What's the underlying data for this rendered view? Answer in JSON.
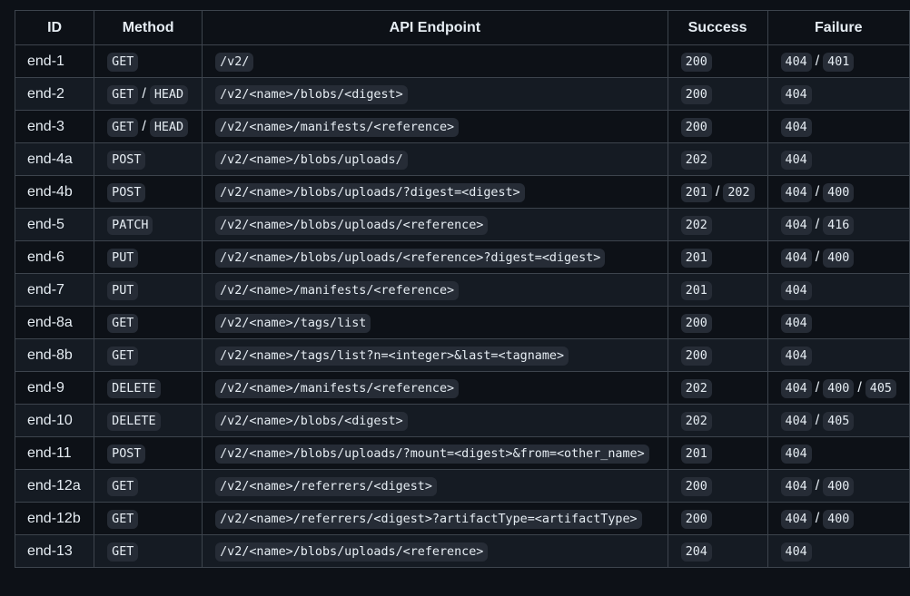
{
  "table": {
    "headers": [
      "ID",
      "Method",
      "API Endpoint",
      "Success",
      "Failure"
    ],
    "rows": [
      {
        "id": "end-1",
        "methods": [
          "GET"
        ],
        "endpoint": "/v2/",
        "success": [
          "200"
        ],
        "failure": [
          "404",
          "401"
        ]
      },
      {
        "id": "end-2",
        "methods": [
          "GET",
          "HEAD"
        ],
        "endpoint": "/v2/<name>/blobs/<digest>",
        "success": [
          "200"
        ],
        "failure": [
          "404"
        ]
      },
      {
        "id": "end-3",
        "methods": [
          "GET",
          "HEAD"
        ],
        "endpoint": "/v2/<name>/manifests/<reference>",
        "success": [
          "200"
        ],
        "failure": [
          "404"
        ]
      },
      {
        "id": "end-4a",
        "methods": [
          "POST"
        ],
        "endpoint": "/v2/<name>/blobs/uploads/",
        "success": [
          "202"
        ],
        "failure": [
          "404"
        ]
      },
      {
        "id": "end-4b",
        "methods": [
          "POST"
        ],
        "endpoint": "/v2/<name>/blobs/uploads/?digest=<digest>",
        "success": [
          "201",
          "202"
        ],
        "failure": [
          "404",
          "400"
        ]
      },
      {
        "id": "end-5",
        "methods": [
          "PATCH"
        ],
        "endpoint": "/v2/<name>/blobs/uploads/<reference>",
        "success": [
          "202"
        ],
        "failure": [
          "404",
          "416"
        ]
      },
      {
        "id": "end-6",
        "methods": [
          "PUT"
        ],
        "endpoint": "/v2/<name>/blobs/uploads/<reference>?digest=<digest>",
        "success": [
          "201"
        ],
        "failure": [
          "404",
          "400"
        ]
      },
      {
        "id": "end-7",
        "methods": [
          "PUT"
        ],
        "endpoint": "/v2/<name>/manifests/<reference>",
        "success": [
          "201"
        ],
        "failure": [
          "404"
        ]
      },
      {
        "id": "end-8a",
        "methods": [
          "GET"
        ],
        "endpoint": "/v2/<name>/tags/list",
        "success": [
          "200"
        ],
        "failure": [
          "404"
        ]
      },
      {
        "id": "end-8b",
        "methods": [
          "GET"
        ],
        "endpoint": "/v2/<name>/tags/list?n=<integer>&last=<tagname>",
        "success": [
          "200"
        ],
        "failure": [
          "404"
        ]
      },
      {
        "id": "end-9",
        "methods": [
          "DELETE"
        ],
        "endpoint": "/v2/<name>/manifests/<reference>",
        "success": [
          "202"
        ],
        "failure": [
          "404",
          "400",
          "405"
        ]
      },
      {
        "id": "end-10",
        "methods": [
          "DELETE"
        ],
        "endpoint": "/v2/<name>/blobs/<digest>",
        "success": [
          "202"
        ],
        "failure": [
          "404",
          "405"
        ]
      },
      {
        "id": "end-11",
        "methods": [
          "POST"
        ],
        "endpoint": "/v2/<name>/blobs/uploads/?mount=<digest>&from=<other_name>",
        "success": [
          "201"
        ],
        "failure": [
          "404"
        ]
      },
      {
        "id": "end-12a",
        "methods": [
          "GET"
        ],
        "endpoint": "/v2/<name>/referrers/<digest>",
        "success": [
          "200"
        ],
        "failure": [
          "404",
          "400"
        ]
      },
      {
        "id": "end-12b",
        "methods": [
          "GET"
        ],
        "endpoint": "/v2/<name>/referrers/<digest>?artifactType=<artifactType>",
        "success": [
          "200"
        ],
        "failure": [
          "404",
          "400"
        ]
      },
      {
        "id": "end-13",
        "methods": [
          "GET"
        ],
        "endpoint": "/v2/<name>/blobs/uploads/<reference>",
        "success": [
          "204"
        ],
        "failure": [
          "404"
        ]
      }
    ],
    "separator": "/"
  }
}
